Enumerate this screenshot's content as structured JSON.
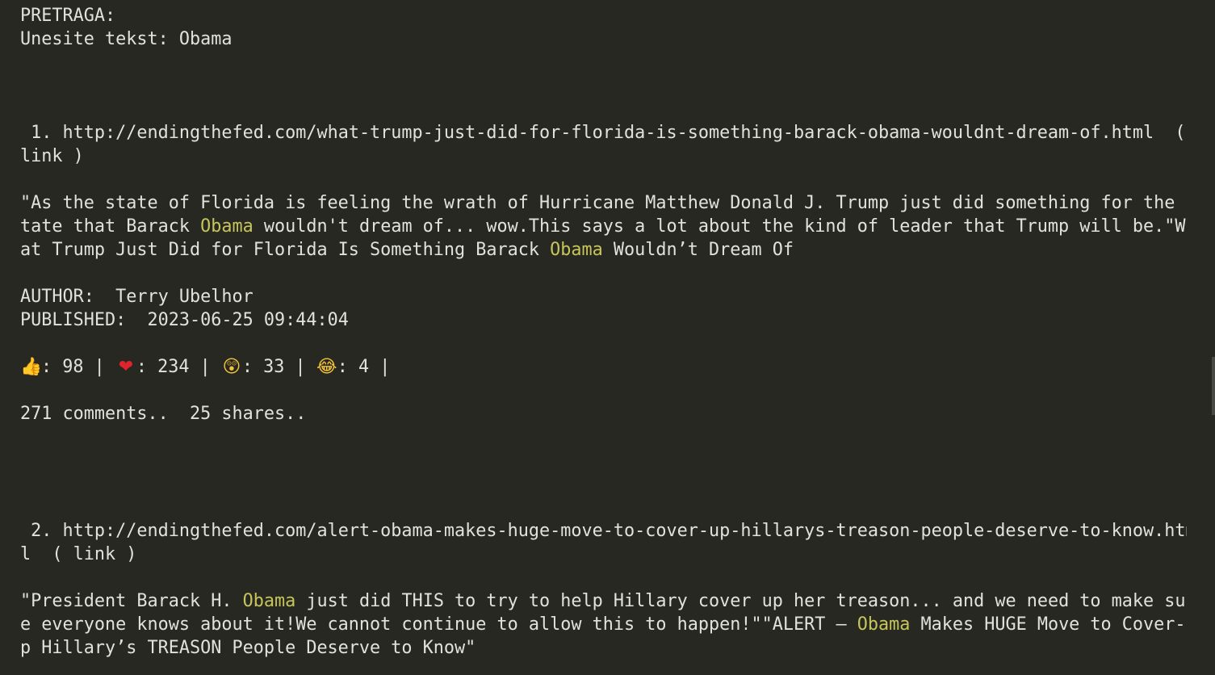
{
  "search": {
    "heading": "PRETRAGA:",
    "prompt": "Unesite tekst: ",
    "query": "Obama"
  },
  "results": [
    {
      "index": " 1. ",
      "url_line1": "http://endingthefed.com/what-trump-just-did-for-florida-is-something-barack-obama-wouldnt-dream-of.html  (",
      "url_line2": "link )",
      "excerpt": {
        "l1": "\"As the state of Florida is feeling the wrath of Hurricane Matthew Donald J. Trump just did something for the s",
        "l2a": "tate that Barack ",
        "l2b": "Obama",
        "l2c": " wouldn't dream of... wow.This says a lot about the kind of leader that Trump will be.\"Wh",
        "l3a": "at Trump Just Did for Florida Is Something Barack ",
        "l3b": "Obama",
        "l3c": " Wouldn’t Dream Of"
      },
      "author_label": "AUTHOR:  ",
      "author": "Terry Ubelhor",
      "published_label": "PUBLISHED:  ",
      "published": "2023-06-25 09:44:04",
      "reactions": {
        "like_icon": "👍",
        "like": ": 98 | ",
        "love_icon": "❤",
        "love": ": 234 | ",
        "wow_icon": "😲",
        "wow": ": 33 | ",
        "haha_icon": "😂",
        "haha": ": 4 |"
      },
      "stats": "271 comments..  25 shares.."
    },
    {
      "index": " 2. ",
      "url_line1": "http://endingthefed.com/alert-obama-makes-huge-move-to-cover-up-hillarys-treason-people-deserve-to-know.htm",
      "url_line2": "l  ( link )",
      "excerpt": {
        "l1a": "\"President Barack H. ",
        "l1b": "Obama",
        "l1c": " just did THIS to try to help Hillary cover up her treason... and we need to make sur",
        "l2a": "e everyone knows about it!We cannot continue to allow this to happen!\"\"ALERT – ",
        "l2b": "Obama",
        "l2c": " Makes HUGE Move to Cover-U",
        "l3": "p Hillary’s TREASON People Deserve to Know\""
      }
    }
  ],
  "icons": {
    "like": "thumbs-up-icon",
    "love": "heart-icon",
    "wow": "astonished-face-icon",
    "haha": "tears-of-joy-icon"
  },
  "colors": {
    "background": "#272822",
    "text": "#e2e2dc",
    "highlight": "#c7c45a"
  }
}
